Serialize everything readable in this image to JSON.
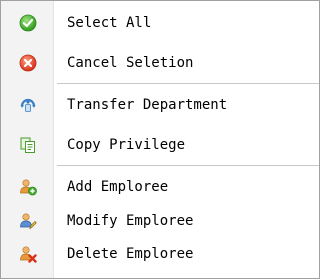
{
  "menu": {
    "items": [
      {
        "label": "Select All",
        "icon": "checkmark-icon"
      },
      {
        "label": "Cancel Seletion",
        "icon": "cancel-icon"
      },
      {
        "label": "Transfer Department",
        "icon": "transfer-icon"
      },
      {
        "label": "Copy Privilege",
        "icon": "copy-icon"
      },
      {
        "label": "Add Emploree",
        "icon": "add-user-icon"
      },
      {
        "label": "Modify Emploree",
        "icon": "edit-user-icon"
      },
      {
        "label": "Delete Emploree",
        "icon": "delete-user-icon"
      }
    ]
  },
  "colors": {
    "check_green": "#3fae2a",
    "cancel_red": "#e8452c",
    "separator": "#c8c8c8",
    "gutter": "#f3f3f3"
  }
}
